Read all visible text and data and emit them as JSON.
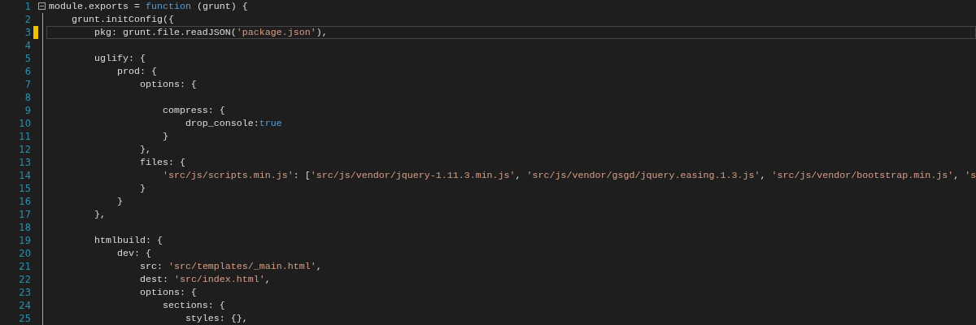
{
  "editor": {
    "lines": [
      {
        "number": "1",
        "current": false,
        "modified": false,
        "fold_start": true,
        "tokens": [
          {
            "kind": "plain",
            "text": "module.exports = "
          },
          {
            "kind": "keyword",
            "text": "function"
          },
          {
            "kind": "plain",
            "text": " (grunt) {"
          }
        ]
      },
      {
        "number": "2",
        "current": false,
        "modified": false,
        "fold_start": false,
        "tokens": [
          {
            "kind": "plain",
            "text": "    grunt.initConfig({"
          }
        ]
      },
      {
        "number": "3",
        "current": true,
        "modified": true,
        "fold_start": false,
        "tokens": [
          {
            "kind": "plain",
            "text": "        pkg: grunt.file.readJSON("
          },
          {
            "kind": "string",
            "text": "'package.json'"
          },
          {
            "kind": "plain",
            "text": "),"
          }
        ]
      },
      {
        "number": "4",
        "current": false,
        "modified": false,
        "fold_start": false
      },
      {
        "number": "5",
        "current": false,
        "modified": false,
        "fold_start": false,
        "tokens": [
          {
            "kind": "plain",
            "text": "        uglify: {"
          }
        ]
      },
      {
        "number": "6",
        "current": false,
        "modified": false,
        "fold_start": false,
        "tokens": [
          {
            "kind": "plain",
            "text": "            prod: {"
          }
        ]
      },
      {
        "number": "7",
        "current": false,
        "modified": false,
        "fold_start": false,
        "tokens": [
          {
            "kind": "plain",
            "text": "                options: {"
          }
        ]
      },
      {
        "number": "8",
        "current": false,
        "modified": false,
        "fold_start": false
      },
      {
        "number": "9",
        "current": false,
        "modified": false,
        "fold_start": false,
        "tokens": [
          {
            "kind": "plain",
            "text": "                    compress: {"
          }
        ]
      },
      {
        "number": "10",
        "current": false,
        "modified": false,
        "fold_start": false,
        "tokens": [
          {
            "kind": "plain",
            "text": "                        drop_console:"
          },
          {
            "kind": "keyword",
            "text": "true"
          }
        ]
      },
      {
        "number": "11",
        "current": false,
        "modified": false,
        "fold_start": false,
        "tokens": [
          {
            "kind": "plain",
            "text": "                    }"
          }
        ]
      },
      {
        "number": "12",
        "current": false,
        "modified": false,
        "fold_start": false,
        "tokens": [
          {
            "kind": "plain",
            "text": "                },"
          }
        ]
      },
      {
        "number": "13",
        "current": false,
        "modified": false,
        "fold_start": false,
        "tokens": [
          {
            "kind": "plain",
            "text": "                files: {"
          }
        ]
      },
      {
        "number": "14",
        "current": false,
        "modified": false,
        "fold_start": false,
        "tokens": [
          {
            "kind": "string",
            "text": "                    'src/js/scripts.min.js'"
          },
          {
            "kind": "plain",
            "text": ": ["
          },
          {
            "kind": "string",
            "text": "'src/js/vendor/jquery-1.11.3.min.js'"
          },
          {
            "kind": "plain",
            "text": ", "
          },
          {
            "kind": "string",
            "text": "'src/js/vendor/gsgd/jquery.easing.1.3.js'"
          },
          {
            "kind": "plain",
            "text": ", "
          },
          {
            "kind": "string",
            "text": "'src/js/vendor/bootstrap.min.js'"
          },
          {
            "kind": "plain",
            "text": ", "
          },
          {
            "kind": "string",
            "text": "'s"
          }
        ]
      },
      {
        "number": "15",
        "current": false,
        "modified": false,
        "fold_start": false,
        "tokens": [
          {
            "kind": "plain",
            "text": "                }"
          }
        ]
      },
      {
        "number": "16",
        "current": false,
        "modified": false,
        "fold_start": false,
        "tokens": [
          {
            "kind": "plain",
            "text": "            }"
          }
        ]
      },
      {
        "number": "17",
        "current": false,
        "modified": false,
        "fold_start": false,
        "tokens": [
          {
            "kind": "plain",
            "text": "        },"
          }
        ]
      },
      {
        "number": "18",
        "current": false,
        "modified": false,
        "fold_start": false
      },
      {
        "number": "19",
        "current": false,
        "modified": false,
        "fold_start": false,
        "tokens": [
          {
            "kind": "plain",
            "text": "        htmlbuild: {"
          }
        ]
      },
      {
        "number": "20",
        "current": false,
        "modified": false,
        "fold_start": false,
        "tokens": [
          {
            "kind": "plain",
            "text": "            dev: {"
          }
        ]
      },
      {
        "number": "21",
        "current": false,
        "modified": false,
        "fold_start": false,
        "tokens": [
          {
            "kind": "plain",
            "text": "                src: "
          },
          {
            "kind": "string",
            "text": "'src/templates/_main.html'"
          },
          {
            "kind": "plain",
            "text": ","
          }
        ]
      },
      {
        "number": "22",
        "current": false,
        "modified": false,
        "fold_start": false,
        "tokens": [
          {
            "kind": "plain",
            "text": "                dest: "
          },
          {
            "kind": "string",
            "text": "'src/index.html'"
          },
          {
            "kind": "plain",
            "text": ","
          }
        ]
      },
      {
        "number": "23",
        "current": false,
        "modified": false,
        "fold_start": false,
        "tokens": [
          {
            "kind": "plain",
            "text": "                options: {"
          }
        ]
      },
      {
        "number": "24",
        "current": false,
        "modified": false,
        "fold_start": false,
        "tokens": [
          {
            "kind": "plain",
            "text": "                    sections: {"
          }
        ]
      },
      {
        "number": "25",
        "current": false,
        "modified": false,
        "fold_start": false,
        "tokens": [
          {
            "kind": "plain",
            "text": "                        styles: {},"
          }
        ]
      }
    ]
  }
}
